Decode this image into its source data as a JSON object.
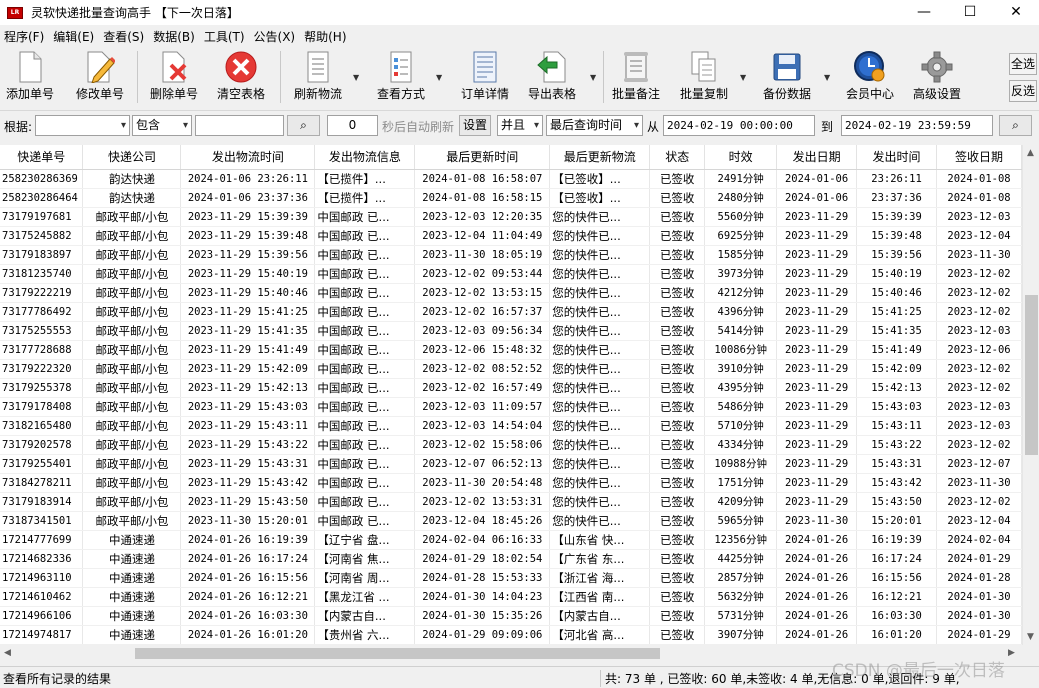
{
  "window": {
    "title": "灵软快递批量查询高手 【下一次日落】",
    "minimize": "—",
    "maximize": "☐",
    "close": "✕"
  },
  "menu": [
    "程序(F)",
    "编辑(E)",
    "查看(S)",
    "数据(B)",
    "工具(T)",
    "公告(X)",
    "帮助(H)"
  ],
  "toolbar": {
    "add": "添加单号",
    "edit": "修改单号",
    "delete": "删除单号",
    "clear": "清空表格",
    "refresh": "刷新物流",
    "view_mode": "查看方式",
    "order_detail": "订单详情",
    "export": "导出表格",
    "batch_note": "批量备注",
    "batch_copy": "批量复制",
    "backup": "备份数据",
    "member": "会员中心",
    "advanced": "高级设置",
    "select_all": "全选",
    "invert": "反选"
  },
  "filter": {
    "label": "根据:",
    "field_value": "",
    "match": "包含",
    "keyword": "",
    "interval": "0",
    "auto_refresh_label": "秒后自动刷新",
    "set": "设置",
    "logic": "并且",
    "time_field": "最后查询时间",
    "from": "从",
    "start": "2024-02-19 00:00:00",
    "to": "到",
    "end": "2024-02-19 23:59:59"
  },
  "table": {
    "columns": [
      "快递单号",
      "快递公司",
      "发出物流时间",
      "发出物流信息",
      "最后更新时间",
      "最后更新物流",
      "状态",
      "时效",
      "发出日期",
      "发出时间",
      "签收日期"
    ],
    "rows": [
      [
        "258230286369",
        "韵达快递",
        "2024-01-06 23:26:11",
        "【已揽件】...",
        "2024-01-08 16:58:07",
        "【已签收】...",
        "已签收",
        "2491分钟",
        "2024-01-06",
        "23:26:11",
        "2024-01-08"
      ],
      [
        "258230286464",
        "韵达快递",
        "2024-01-06 23:37:36",
        "【已揽件】...",
        "2024-01-08 16:58:15",
        "【已签收】...",
        "已签收",
        "2480分钟",
        "2024-01-06",
        "23:37:36",
        "2024-01-08"
      ],
      [
        "73179197681",
        "邮政平邮/小包",
        "2023-11-29 15:39:39",
        "中国邮政 已...",
        "2023-12-03 12:20:35",
        "您的快件已...",
        "已签收",
        "5560分钟",
        "2023-11-29",
        "15:39:39",
        "2023-12-03"
      ],
      [
        "73175245882",
        "邮政平邮/小包",
        "2023-11-29 15:39:48",
        "中国邮政 已...",
        "2023-12-04 11:04:49",
        "您的快件已...",
        "已签收",
        "6925分钟",
        "2023-11-29",
        "15:39:48",
        "2023-12-04"
      ],
      [
        "73179183897",
        "邮政平邮/小包",
        "2023-11-29 15:39:56",
        "中国邮政 已...",
        "2023-11-30 18:05:19",
        "您的快件已...",
        "已签收",
        "1585分钟",
        "2023-11-29",
        "15:39:56",
        "2023-11-30"
      ],
      [
        "73181235740",
        "邮政平邮/小包",
        "2023-11-29 15:40:19",
        "中国邮政 已...",
        "2023-12-02 09:53:44",
        "您的快件已...",
        "已签收",
        "3973分钟",
        "2023-11-29",
        "15:40:19",
        "2023-12-02"
      ],
      [
        "73179222219",
        "邮政平邮/小包",
        "2023-11-29 15:40:46",
        "中国邮政 已...",
        "2023-12-02 13:53:15",
        "您的快件已...",
        "已签收",
        "4212分钟",
        "2023-11-29",
        "15:40:46",
        "2023-12-02"
      ],
      [
        "73177786492",
        "邮政平邮/小包",
        "2023-11-29 15:41:25",
        "中国邮政 已...",
        "2023-12-02 16:57:37",
        "您的快件已...",
        "已签收",
        "4396分钟",
        "2023-11-29",
        "15:41:25",
        "2023-12-02"
      ],
      [
        "73175255553",
        "邮政平邮/小包",
        "2023-11-29 15:41:35",
        "中国邮政 已...",
        "2023-12-03 09:56:34",
        "您的快件已...",
        "已签收",
        "5414分钟",
        "2023-11-29",
        "15:41:35",
        "2023-12-03"
      ],
      [
        "73177728688",
        "邮政平邮/小包",
        "2023-11-29 15:41:49",
        "中国邮政 已...",
        "2023-12-06 15:48:32",
        "您的快件已...",
        "已签收",
        "10086分钟",
        "2023-11-29",
        "15:41:49",
        "2023-12-06"
      ],
      [
        "73179222320",
        "邮政平邮/小包",
        "2023-11-29 15:42:09",
        "中国邮政 已...",
        "2023-12-02 08:52:52",
        "您的快件已...",
        "已签收",
        "3910分钟",
        "2023-11-29",
        "15:42:09",
        "2023-12-02"
      ],
      [
        "73179255378",
        "邮政平邮/小包",
        "2023-11-29 15:42:13",
        "中国邮政 已...",
        "2023-12-02 16:57:49",
        "您的快件已...",
        "已签收",
        "4395分钟",
        "2023-11-29",
        "15:42:13",
        "2023-12-02"
      ],
      [
        "73179178408",
        "邮政平邮/小包",
        "2023-11-29 15:43:03",
        "中国邮政 已...",
        "2023-12-03 11:09:57",
        "您的快件已...",
        "已签收",
        "5486分钟",
        "2023-11-29",
        "15:43:03",
        "2023-12-03"
      ],
      [
        "73182165480",
        "邮政平邮/小包",
        "2023-11-29 15:43:11",
        "中国邮政 已...",
        "2023-12-03 14:54:04",
        "您的快件已...",
        "已签收",
        "5710分钟",
        "2023-11-29",
        "15:43:11",
        "2023-12-03"
      ],
      [
        "73179202578",
        "邮政平邮/小包",
        "2023-11-29 15:43:22",
        "中国邮政 已...",
        "2023-12-02 15:58:06",
        "您的快件已...",
        "已签收",
        "4334分钟",
        "2023-11-29",
        "15:43:22",
        "2023-12-02"
      ],
      [
        "73179255401",
        "邮政平邮/小包",
        "2023-11-29 15:43:31",
        "中国邮政 已...",
        "2023-12-07 06:52:13",
        "您的快件已...",
        "已签收",
        "10988分钟",
        "2023-11-29",
        "15:43:31",
        "2023-12-07"
      ],
      [
        "73184278211",
        "邮政平邮/小包",
        "2023-11-29 15:43:42",
        "中国邮政 已...",
        "2023-11-30 20:54:48",
        "您的快件已...",
        "已签收",
        "1751分钟",
        "2023-11-29",
        "15:43:42",
        "2023-11-30"
      ],
      [
        "73179183914",
        "邮政平邮/小包",
        "2023-11-29 15:43:50",
        "中国邮政 已...",
        "2023-12-02 13:53:31",
        "您的快件已...",
        "已签收",
        "4209分钟",
        "2023-11-29",
        "15:43:50",
        "2023-12-02"
      ],
      [
        "73187341501",
        "邮政平邮/小包",
        "2023-11-30 15:20:01",
        "中国邮政 已...",
        "2023-12-04 18:45:26",
        "您的快件已...",
        "已签收",
        "5965分钟",
        "2023-11-30",
        "15:20:01",
        "2023-12-04"
      ],
      [
        "17214777699",
        "中通速递",
        "2024-01-26 16:19:39",
        "【辽宁省 盘...",
        "2024-02-04 06:16:33",
        "【山东省 快...",
        "已签收",
        "12356分钟",
        "2024-01-26",
        "16:19:39",
        "2024-02-04"
      ],
      [
        "17214682336",
        "中通速递",
        "2024-01-26 16:17:24",
        "【河南省 焦...",
        "2024-01-29 18:02:54",
        "【广东省 东...",
        "已签收",
        "4425分钟",
        "2024-01-26",
        "16:17:24",
        "2024-01-29"
      ],
      [
        "17214963110",
        "中通速递",
        "2024-01-26 16:15:56",
        "【河南省 周...",
        "2024-01-28 15:53:33",
        "【浙江省 海...",
        "已签收",
        "2857分钟",
        "2024-01-26",
        "16:15:56",
        "2024-01-28"
      ],
      [
        "17214610462",
        "中通速递",
        "2024-01-26 16:12:21",
        "【黑龙江省 ...",
        "2024-01-30 14:04:23",
        "【江西省 南...",
        "已签收",
        "5632分钟",
        "2024-01-26",
        "16:12:21",
        "2024-01-30"
      ],
      [
        "17214966106",
        "中通速递",
        "2024-01-26 16:03:30",
        "【内蒙古自...",
        "2024-01-30 15:35:26",
        "【内蒙古自...",
        "已签收",
        "5731分钟",
        "2024-01-26",
        "16:03:30",
        "2024-01-30"
      ],
      [
        "17214974817",
        "中通速递",
        "2024-01-26 16:01:20",
        "【贵州省 六...",
        "2024-01-29 09:09:06",
        "【河北省 高...",
        "已签收",
        "3907分钟",
        "2024-01-26",
        "16:01:20",
        "2024-01-29"
      ]
    ]
  },
  "status": {
    "left": "查看所有记录的结果",
    "right": "共: 73 单 , 已签收: 60 单,未签收: 4 单,无信息: 0 单,退回件: 9 单,"
  },
  "watermark": "CSDN @最后一次日落",
  "colors": {
    "delete_red": "#e53935",
    "status_text": "#000000"
  }
}
